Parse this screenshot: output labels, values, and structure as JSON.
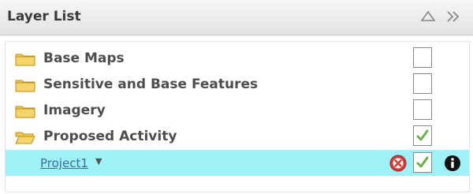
{
  "panel": {
    "title": "Layer List",
    "collapse_icon": "triangle-up-icon",
    "expand_icon": "double-chevron-right-icon"
  },
  "layers": [
    {
      "label": "Base Maps",
      "checked": false,
      "icon": "folder-icon"
    },
    {
      "label": "Sensitive and Base Features",
      "checked": false,
      "icon": "folder-icon"
    },
    {
      "label": "Imagery",
      "checked": false,
      "icon": "folder-icon"
    },
    {
      "label": "Proposed Activity",
      "checked": true,
      "icon": "folder-open-icon"
    }
  ],
  "sublayer": {
    "label": "Project1",
    "dropdown_glyph": "▼",
    "checked": true,
    "highlight_color": "#9ff0f7",
    "remove_icon": "remove-circle-icon",
    "info_icon": "info-icon"
  },
  "colors": {
    "check": "#6ab04c",
    "remove": "#d63b3b",
    "folder": "#f2c94c"
  }
}
